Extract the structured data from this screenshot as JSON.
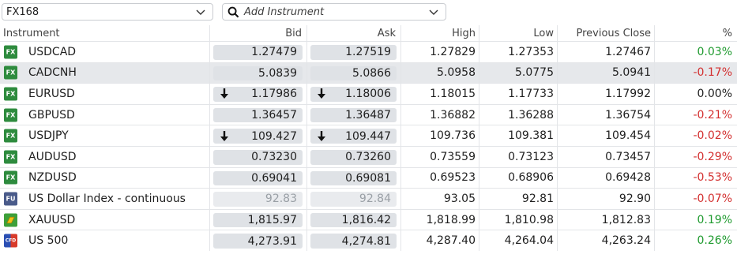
{
  "watchlist": {
    "selected": "FX168"
  },
  "add_instrument": {
    "placeholder": "Add Instrument"
  },
  "columns": {
    "instrument": "Instrument",
    "bid": "Bid",
    "ask": "Ask",
    "high": "High",
    "low": "Low",
    "previous_close": "Previous Close",
    "percent": "%"
  },
  "rows": [
    {
      "icon": "FX",
      "name": "USDCAD",
      "bid": "1.27479",
      "ask": "1.27519",
      "high": "1.27829",
      "low": "1.27353",
      "prev": "1.27467",
      "pct": "0.03%",
      "trend": "pos",
      "arrow": false,
      "dim": false,
      "selected": false
    },
    {
      "icon": "FX",
      "name": "CADCNH",
      "bid": "5.0839",
      "ask": "5.0866",
      "high": "5.0958",
      "low": "5.0775",
      "prev": "5.0941",
      "pct": "-0.17%",
      "trend": "neg",
      "arrow": false,
      "dim": false,
      "selected": true
    },
    {
      "icon": "FX",
      "name": "EURUSD",
      "bid": "1.17986",
      "ask": "1.18006",
      "high": "1.18015",
      "low": "1.17733",
      "prev": "1.17992",
      "pct": "0.00%",
      "trend": "flat",
      "arrow": true,
      "dim": false,
      "selected": false
    },
    {
      "icon": "FX",
      "name": "GBPUSD",
      "bid": "1.36457",
      "ask": "1.36487",
      "high": "1.36882",
      "low": "1.36288",
      "prev": "1.36754",
      "pct": "-0.21%",
      "trend": "neg",
      "arrow": false,
      "dim": false,
      "selected": false
    },
    {
      "icon": "FX",
      "name": "USDJPY",
      "bid": "109.427",
      "ask": "109.447",
      "high": "109.736",
      "low": "109.381",
      "prev": "109.454",
      "pct": "-0.02%",
      "trend": "neg",
      "arrow": true,
      "dim": false,
      "selected": false
    },
    {
      "icon": "FX",
      "name": "AUDUSD",
      "bid": "0.73230",
      "ask": "0.73260",
      "high": "0.73559",
      "low": "0.73123",
      "prev": "0.73457",
      "pct": "-0.29%",
      "trend": "neg",
      "arrow": false,
      "dim": false,
      "selected": false
    },
    {
      "icon": "FX",
      "name": "NZDUSD",
      "bid": "0.69041",
      "ask": "0.69081",
      "high": "0.69523",
      "low": "0.68906",
      "prev": "0.69428",
      "pct": "-0.53%",
      "trend": "neg",
      "arrow": false,
      "dim": false,
      "selected": false
    },
    {
      "icon": "FU",
      "name": "US Dollar Index - continuous",
      "bid": "92.83",
      "ask": "92.84",
      "high": "93.05",
      "low": "92.81",
      "prev": "92.90",
      "pct": "-0.07%",
      "trend": "neg",
      "arrow": false,
      "dim": true,
      "selected": false
    },
    {
      "icon": "gold",
      "name": "XAUUSD",
      "bid": "1,815.97",
      "ask": "1,816.42",
      "high": "1,818.99",
      "low": "1,810.98",
      "prev": "1,812.83",
      "pct": "0.19%",
      "trend": "pos",
      "arrow": false,
      "dim": false,
      "selected": false
    },
    {
      "icon": "CFD",
      "name": "US 500",
      "bid": "4,273.91",
      "ask": "4,274.81",
      "high": "4,287.40",
      "low": "4,264.04",
      "prev": "4,263.24",
      "pct": "0.26%",
      "trend": "pos",
      "arrow": false,
      "dim": false,
      "selected": false
    }
  ],
  "colors": {
    "positive": "#1e9a2e",
    "negative": "#d32f2f",
    "fx_icon": "#2e8b3e",
    "selected_row": "#e6e8eb"
  }
}
